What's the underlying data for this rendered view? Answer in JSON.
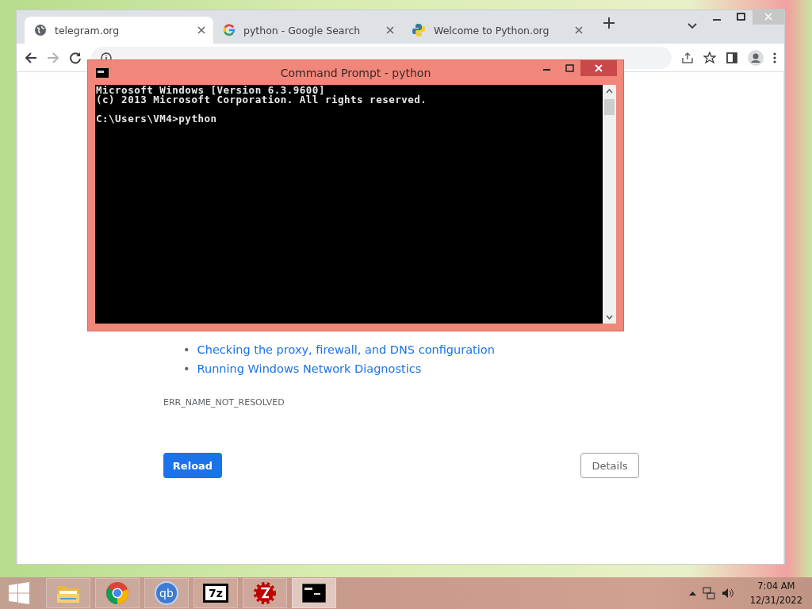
{
  "browser": {
    "tabs": [
      {
        "title": "telegram.org",
        "selected": true,
        "kind": "globe"
      },
      {
        "title": "python - Google Search",
        "selected": false,
        "kind": "google"
      },
      {
        "title": "Welcome to Python.org",
        "selected": false,
        "kind": "python"
      }
    ],
    "page": {
      "suggestions": [
        {
          "marker": "•",
          "text": "Checking the proxy, firewall, and DNS configuration",
          "kind": "link"
        },
        {
          "marker": "•",
          "text": "Running Windows Network Diagnostics",
          "kind": "link"
        }
      ],
      "error_code": "ERR_NAME_NOT_RESOLVED",
      "buttons": [
        {
          "label": "Reload",
          "kind": "primary"
        },
        {
          "label": "Details",
          "kind": "secondary"
        }
      ]
    }
  },
  "console": {
    "title": "Command Prompt - python",
    "output": [
      "Microsoft Windows [Version 6.3.9600]",
      "(c) 2013 Microsoft Corporation. All rights reserved."
    ],
    "prompt": "C:\\Users\\VM4>python"
  },
  "taskbar": {
    "items": [
      {
        "kind": "explorer",
        "selected": false
      },
      {
        "kind": "chrome",
        "selected": false
      },
      {
        "kind": "qbittorrent",
        "glyph": "qb",
        "selected": false
      },
      {
        "kind": "sevenzip",
        "glyph": "7z",
        "selected": false
      },
      {
        "kind": "filezilla",
        "selected": false
      },
      {
        "kind": "console",
        "selected": true
      }
    ],
    "time": "7:04 AM",
    "date": "12/31/2022"
  }
}
